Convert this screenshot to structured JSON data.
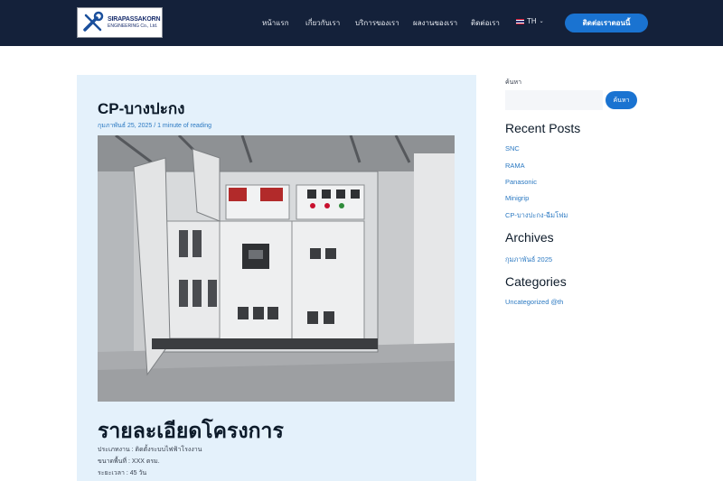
{
  "header": {
    "logo": {
      "name": "SIRAPASSAKORN",
      "sub": "ENGINEERING Co., Ltd."
    },
    "nav": [
      {
        "label": "หน้าแรก"
      },
      {
        "label": "เกี่ยวกับเรา"
      },
      {
        "label": "บริการของเรา"
      },
      {
        "label": "ผลงานของเรา"
      },
      {
        "label": "ติดต่อเรา"
      }
    ],
    "language": "TH",
    "cta_label": "ติดต่อเราตอนนี้"
  },
  "post": {
    "title": "CP-บางปะกง",
    "meta": "กุมภาพันธ์ 25, 2025 / 1 minute of reading",
    "section_heading": "รายละเอียดโครงการ",
    "details": [
      "ประเภทงาน :   ติดตั้งระบบไฟฟ้าโรงงาน",
      "ขนาดพื้นที่ :   XXX  ตรม.",
      "ระยะเวลา :   45 วัน"
    ]
  },
  "sidebar": {
    "search_label": "ค้นหา",
    "search_value": "",
    "search_button": "ค้นหา",
    "recent_title": "Recent Posts",
    "recent_posts": [
      "SNC",
      "RAMA",
      "Panasonic",
      "Minigrip",
      "CP-บางปะกง-ฉีมโฟม"
    ],
    "archives_title": "Archives",
    "archives": [
      "กุมภาพันธ์ 2025"
    ],
    "categories_title": "Categories",
    "categories": [
      "Uncategorized @th"
    ]
  },
  "colors": {
    "header_bg": "#14213a",
    "accent": "#1a73d1",
    "article_bg": "#e4f1fb",
    "link": "#2b79c2"
  }
}
